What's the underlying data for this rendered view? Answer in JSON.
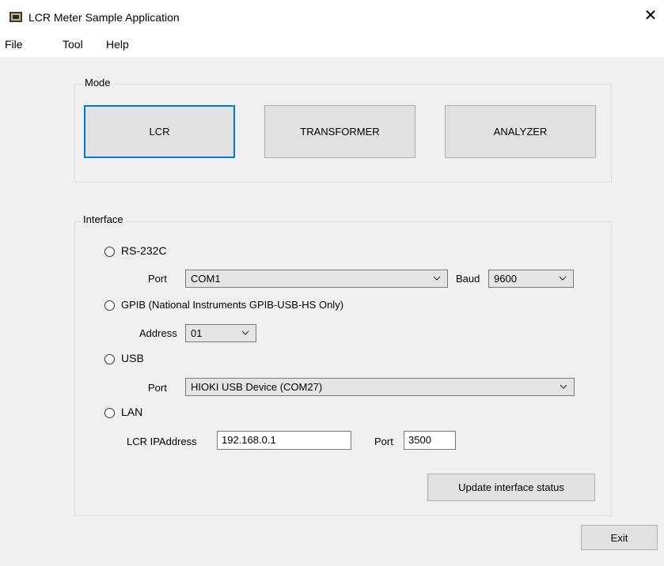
{
  "window": {
    "title": "LCR Meter Sample Application",
    "close_glyph": "✕",
    "icon": "app-icon"
  },
  "menu": [
    "File",
    "Tool",
    "Help"
  ],
  "mode": {
    "title": "Mode",
    "buttons": [
      "LCR",
      "TRANSFORMER",
      "ANALYZER"
    ],
    "selected": "LCR"
  },
  "interface": {
    "title": "Interface",
    "rs232c": {
      "label": "RS-232C",
      "port_label": "Port",
      "port_value": "COM1",
      "baud_label": "Baud",
      "baud_value": "9600"
    },
    "gpib": {
      "label": "GPIB (National Instruments GPIB-USB-HS Only)",
      "address_label": "Address",
      "address_value": "01"
    },
    "usb": {
      "label": "USB",
      "port_label": "Port",
      "port_value": "HIOKI USB Device (COM27)"
    },
    "lan": {
      "label": "LAN",
      "ip_label": "LCR IPAddress",
      "ip_value": "192.168.0.1",
      "port_label": "Port",
      "port_value": "3500"
    },
    "update_button": "Update interface status"
  },
  "exit_button": "Exit",
  "colors": {
    "focus_border": "#0078d7",
    "client_bg": "#f0f0f0",
    "button_bg": "#e1e1e1"
  }
}
